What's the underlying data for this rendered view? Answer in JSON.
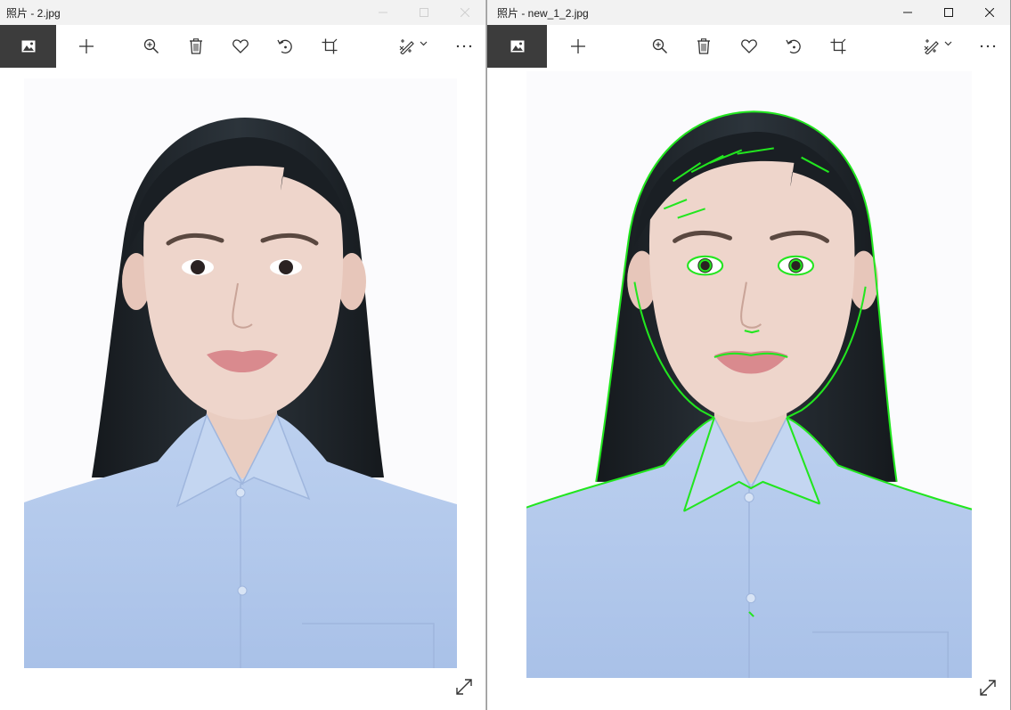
{
  "windows": [
    {
      "title": "照片 - 2.jpg",
      "state": "inactive",
      "caption": {
        "minimize_icon": "minimize-icon",
        "maximize_icon": "maximize-icon",
        "close_icon": "close-icon"
      },
      "toolbar": [
        "photo-gallery-icon",
        "add-icon",
        "zoom-in-icon",
        "delete-icon",
        "favorite-heart-icon",
        "rotate-icon",
        "crop-icon",
        "edit-draw-icon",
        "chevron-down-icon",
        "more-options-icon"
      ],
      "image": {
        "content": "portrait photo, original",
        "contour_overlay": false
      },
      "expand_icon": "expand-fullscreen-icon"
    },
    {
      "title": "照片 - new_1_2.jpg",
      "state": "active",
      "caption": {
        "minimize_icon": "minimize-icon",
        "maximize_icon": "maximize-icon",
        "close_icon": "close-icon"
      },
      "toolbar": [
        "photo-gallery-icon",
        "add-icon",
        "zoom-in-icon",
        "delete-icon",
        "favorite-heart-icon",
        "rotate-icon",
        "crop-icon",
        "edit-draw-icon",
        "chevron-down-icon",
        "more-options-icon"
      ],
      "image": {
        "content": "portrait photo with green detected contours",
        "contour_overlay": true
      },
      "expand_icon": "expand-fullscreen-icon"
    }
  ],
  "colors": {
    "titlebar_bg": "#f2f2f2",
    "toolbar_active_bg": "#3c3c3c",
    "photo_background": "#fbfbfd",
    "hair": "#1d2329",
    "skin": "#eed5cb",
    "shirt": "#b8cdec",
    "lips": "#d98a8e",
    "contour": "#22e61f"
  }
}
